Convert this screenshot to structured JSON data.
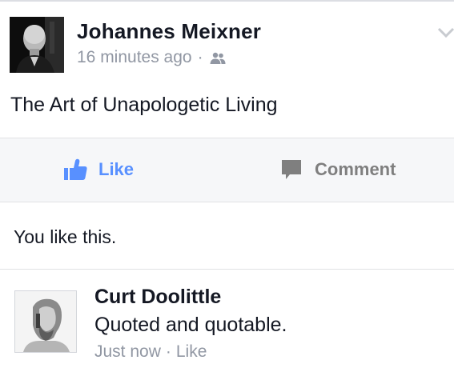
{
  "post": {
    "author_name": "Johannes Meixner",
    "timestamp": "16 minutes ago",
    "separator": "·",
    "privacy_icon": "friends-icon",
    "menu_icon": "chevron-down-icon",
    "text": "The Art of Unapologetic Living"
  },
  "actions": {
    "like_label": "Like",
    "like_icon": "thumbs-up-icon",
    "comment_label": "Comment",
    "comment_icon": "speech-bubble-icon",
    "like_color": "#5890ff",
    "comment_color": "#7f7f7f"
  },
  "likes_summary": "You like this.",
  "comment": {
    "author_name": "Curt Doolittle",
    "text": "Quoted and quotable.",
    "timestamp": "Just now",
    "separator": "·",
    "like_label": "Like"
  }
}
